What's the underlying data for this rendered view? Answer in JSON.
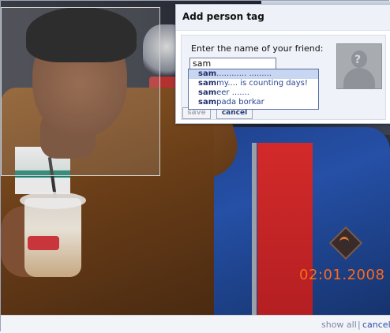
{
  "dialog": {
    "title": "Add person tag",
    "prompt": "Enter the name of your friend:",
    "input_value": "sam",
    "save_label": "save",
    "cancel_label": "cancel"
  },
  "suggestions": [
    {
      "match": "sam",
      "rest": "............ ........."
    },
    {
      "match": "sam",
      "rest": "my.... is counting days!"
    },
    {
      "match": "sam",
      "rest": "eer ......."
    },
    {
      "match": "sam",
      "rest": "pada borkar"
    }
  ],
  "photo": {
    "date_stamp": "02:01.2008"
  },
  "footer": {
    "show_all": "show all",
    "separator": "|",
    "cancel": "cancel"
  }
}
